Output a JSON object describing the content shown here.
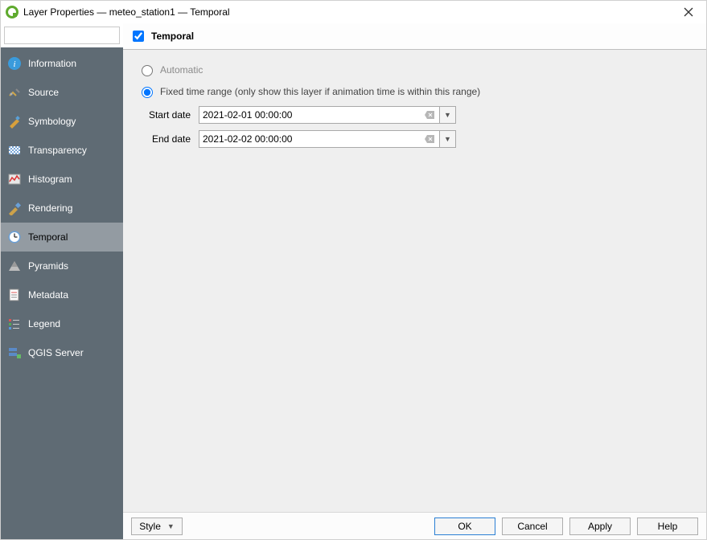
{
  "window": {
    "title": "Layer Properties — meteo_station1 — Temporal"
  },
  "search": {
    "placeholder": ""
  },
  "sidebar": {
    "items": [
      {
        "id": "information",
        "label": "Information"
      },
      {
        "id": "source",
        "label": "Source"
      },
      {
        "id": "symbology",
        "label": "Symbology"
      },
      {
        "id": "transparency",
        "label": "Transparency"
      },
      {
        "id": "histogram",
        "label": "Histogram"
      },
      {
        "id": "rendering",
        "label": "Rendering"
      },
      {
        "id": "temporal",
        "label": "Temporal"
      },
      {
        "id": "pyramids",
        "label": "Pyramids"
      },
      {
        "id": "metadata",
        "label": "Metadata"
      },
      {
        "id": "legend",
        "label": "Legend"
      },
      {
        "id": "qgisserver",
        "label": "QGIS Server"
      }
    ],
    "selected_index": 6
  },
  "panel": {
    "checkbox_checked": true,
    "heading": "Temporal",
    "mode": {
      "automatic_label": "Automatic",
      "fixed_label": "Fixed time range (only show this layer if animation time is within this range)",
      "selected": "fixed"
    },
    "fields": {
      "start_label": "Start date",
      "start_value": "2021-02-01 00:00:00",
      "end_label": "End date",
      "end_value": "2021-02-02 00:00:00"
    }
  },
  "footer": {
    "style": "Style",
    "ok": "OK",
    "cancel": "Cancel",
    "apply": "Apply",
    "help": "Help"
  }
}
